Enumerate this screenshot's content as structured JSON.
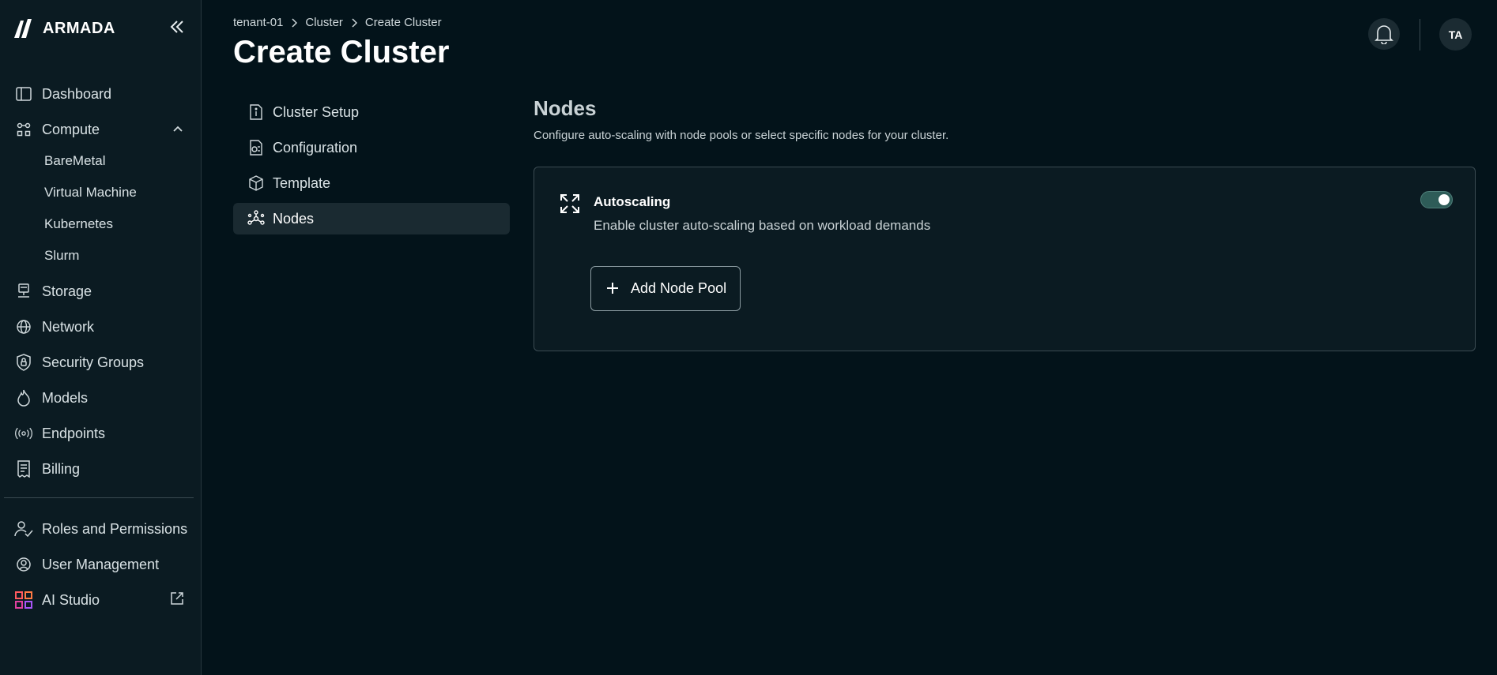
{
  "brand": {
    "name": "ARMADA"
  },
  "sidebar": {
    "items": [
      {
        "label": "Dashboard",
        "icon": "sidebar-panel-icon"
      },
      {
        "label": "Compute",
        "icon": "compute-icon"
      },
      {
        "label": "BareMetal"
      },
      {
        "label": "Virtual Machine"
      },
      {
        "label": "Kubernetes"
      },
      {
        "label": "Slurm"
      },
      {
        "label": "Storage",
        "icon": "storage-icon"
      },
      {
        "label": "Network",
        "icon": "globe-icon"
      },
      {
        "label": "Security Groups",
        "icon": "shield-lock-icon"
      },
      {
        "label": "Models",
        "icon": "flame-icon"
      },
      {
        "label": "Endpoints",
        "icon": "broadcast-icon"
      },
      {
        "label": "Billing",
        "icon": "receipt-icon"
      }
    ],
    "bottom_items": [
      {
        "label": "Roles and Permissions",
        "icon": "user-check-icon"
      },
      {
        "label": "User Management",
        "icon": "user-gear-icon"
      },
      {
        "label": "AI Studio",
        "icon": "ai-studio-grid-icon"
      }
    ]
  },
  "header": {
    "breadcrumb": [
      "tenant-01",
      "Cluster",
      "Create Cluster"
    ],
    "title": "Create Cluster",
    "avatar_initials": "TA"
  },
  "steps": [
    {
      "label": "Cluster Setup",
      "icon": "info-doc-icon"
    },
    {
      "label": "Configuration",
      "icon": "config-doc-icon"
    },
    {
      "label": "Template",
      "icon": "cube-icon"
    },
    {
      "label": "Nodes",
      "icon": "nodes-icon",
      "active": true
    }
  ],
  "nodes_section": {
    "title": "Nodes",
    "description": "Configure auto-scaling with node pools or select specific nodes for your cluster.",
    "autoscaling": {
      "title": "Autoscaling",
      "description": "Enable cluster auto-scaling based on workload demands",
      "enabled": true
    },
    "add_node_pool_label": "Add Node Pool"
  },
  "colors": {
    "background": "#03131a",
    "sidebar": "#0b1b22",
    "accent_toggle": "#2e5c58"
  }
}
